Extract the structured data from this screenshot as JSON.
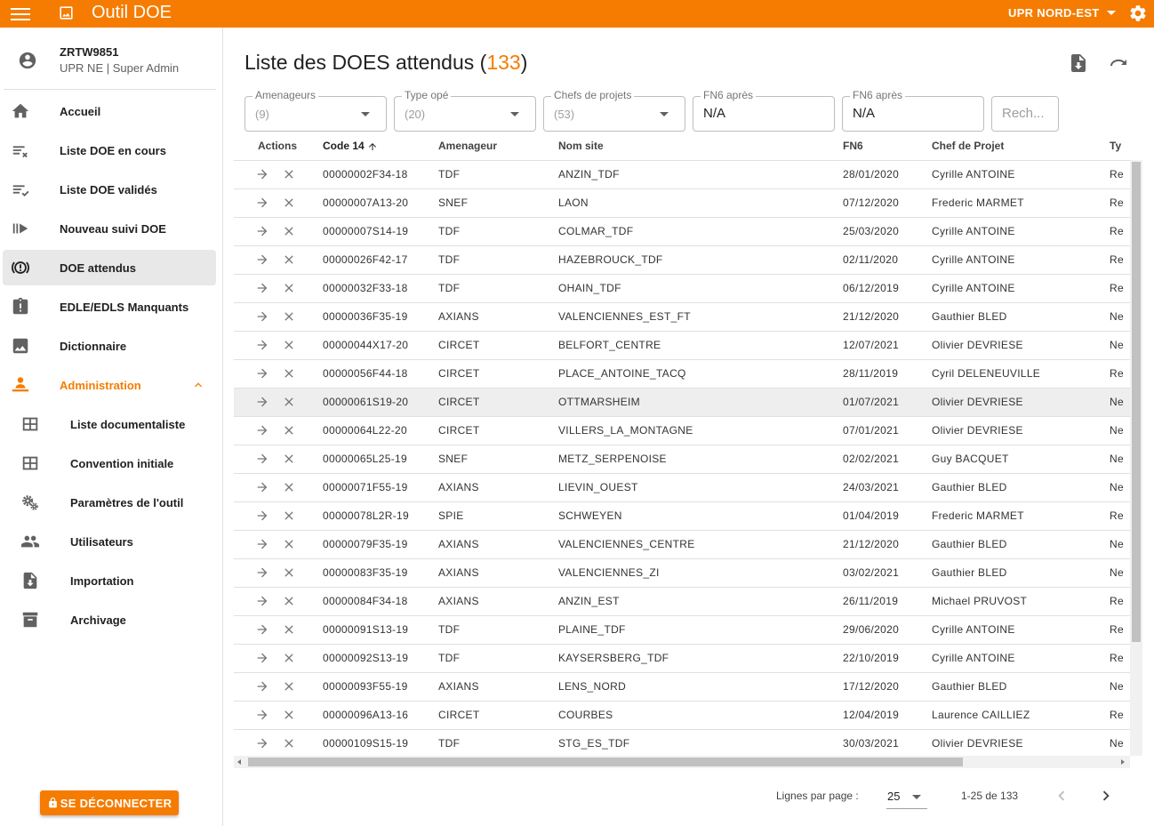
{
  "app": {
    "title": "Outil DOE",
    "region": "UPR NORD-EST"
  },
  "user": {
    "id": "ZRTW9851",
    "role": "UPR NE | Super Admin"
  },
  "nav": [
    {
      "label": "Accueil",
      "icon": "home-icon"
    },
    {
      "label": "Liste DOE en cours",
      "icon": "list-clear-icon"
    },
    {
      "label": "Liste DOE validés",
      "icon": "list-check-icon"
    },
    {
      "label": "Nouveau suivi DOE",
      "icon": "play-track-icon"
    },
    {
      "label": "DOE attendus",
      "icon": "pending-actions-icon"
    },
    {
      "label": "EDLE/EDLS Manquants",
      "icon": "clipboard-alert-icon"
    },
    {
      "label": "Dictionnaire",
      "icon": "image-icon"
    },
    {
      "label": "Administration",
      "icon": "admin-person-icon"
    }
  ],
  "admin_sub": [
    {
      "label": "Liste documentaliste",
      "icon": "table-icon"
    },
    {
      "label": "Convention initiale",
      "icon": "table-icon"
    },
    {
      "label": "Paramètres de l'outil",
      "icon": "cogs-icon"
    },
    {
      "label": "Utilisateurs",
      "icon": "people-icon"
    },
    {
      "label": "Importation",
      "icon": "file-import-icon"
    },
    {
      "label": "Archivage",
      "icon": "archive-icon"
    }
  ],
  "logout_label": "SE DÉCONNECTER",
  "page": {
    "title": "Liste des DOES attendus (",
    "count": "133",
    "title_end": ")"
  },
  "filters": {
    "amenageurs": {
      "label": "Amenageurs",
      "value": "(9)"
    },
    "type_ope": {
      "label": "Type opé",
      "value": "(20)"
    },
    "chefs": {
      "label": "Chefs de projets",
      "value": "(53)"
    },
    "fn6_apres_1": {
      "label": "FN6 après",
      "value": "N/A"
    },
    "fn6_apres_2": {
      "label": "FN6 après",
      "value": "N/A"
    },
    "search": {
      "placeholder": "Rech..."
    }
  },
  "table": {
    "headers": [
      "Actions",
      "Code 14",
      "Amenageur",
      "Nom site",
      "FN6",
      "Chef de Projet",
      "Ty"
    ],
    "rows": [
      [
        "00000002F34-18",
        "TDF",
        "ANZIN_TDF",
        "28/01/2020",
        "Cyrille ANTOINE",
        "Re"
      ],
      [
        "00000007A13-20",
        "SNEF",
        "LAON",
        "07/12/2020",
        "Frederic MARMET",
        "Re"
      ],
      [
        "00000007S14-19",
        "TDF",
        "COLMAR_TDF",
        "25/03/2020",
        "Cyrille ANTOINE",
        "Re"
      ],
      [
        "00000026F42-17",
        "TDF",
        "HAZEBROUCK_TDF",
        "02/11/2020",
        "Cyrille ANTOINE",
        "Re"
      ],
      [
        "00000032F33-18",
        "TDF",
        "OHAIN_TDF",
        "06/12/2019",
        "Cyrille ANTOINE",
        "Re"
      ],
      [
        "00000036F35-19",
        "AXIANS",
        "VALENCIENNES_EST_FT",
        "21/12/2020",
        "Gauthier BLED",
        "Ne"
      ],
      [
        "00000044X17-20",
        "CIRCET",
        "BELFORT_CENTRE",
        "12/07/2021",
        "Olivier DEVRIESE",
        "Ne"
      ],
      [
        "00000056F44-18",
        "CIRCET",
        "PLACE_ANTOINE_TACQ",
        "28/11/2019",
        "Cyril DELENEUVILLE",
        "Re"
      ],
      [
        "00000061S19-20",
        "CIRCET",
        "OTTMARSHEIM",
        "01/07/2021",
        "Olivier DEVRIESE",
        "Ne"
      ],
      [
        "00000064L22-20",
        "CIRCET",
        "VILLERS_LA_MONTAGNE",
        "07/01/2021",
        "Olivier DEVRIESE",
        "Ne"
      ],
      [
        "00000065L25-19",
        "SNEF",
        "METZ_SERPENOISE",
        "02/02/2021",
        "Guy BACQUET",
        "Ne"
      ],
      [
        "00000071F55-19",
        "AXIANS",
        "LIEVIN_OUEST",
        "24/03/2021",
        "Gauthier BLED",
        "Ne"
      ],
      [
        "00000078L2R-19",
        "SPIE",
        "SCHWEYEN",
        "01/04/2019",
        "Frederic MARMET",
        "Re"
      ],
      [
        "00000079F35-19",
        "AXIANS",
        "VALENCIENNES_CENTRE",
        "21/12/2020",
        "Gauthier BLED",
        "Ne"
      ],
      [
        "00000083F35-19",
        "AXIANS",
        "VALENCIENNES_ZI",
        "03/02/2021",
        "Gauthier BLED",
        "Ne"
      ],
      [
        "00000084F34-18",
        "AXIANS",
        "ANZIN_EST",
        "26/11/2019",
        "Michael PRUVOST",
        "Re"
      ],
      [
        "00000091S13-19",
        "TDF",
        "PLAINE_TDF",
        "29/06/2020",
        "Cyrille ANTOINE",
        "Re"
      ],
      [
        "00000092S13-19",
        "TDF",
        "KAYSERSBERG_TDF",
        "22/10/2019",
        "Cyrille ANTOINE",
        "Re"
      ],
      [
        "00000093F55-19",
        "AXIANS",
        "LENS_NORD",
        "17/12/2020",
        "Gauthier BLED",
        "Ne"
      ],
      [
        "00000096A13-16",
        "CIRCET",
        "COURBES",
        "12/04/2019",
        "Laurence CAILLIEZ",
        "Re"
      ],
      [
        "00000109S15-19",
        "TDF",
        "STG_ES_TDF",
        "30/03/2021",
        "Olivier DEVRIESE",
        "Ne"
      ]
    ],
    "highlighted_row": 8
  },
  "pagination": {
    "label": "Lignes par page :",
    "per_page": "25",
    "range": "1-25 de 133"
  },
  "colors": {
    "accent": "#f57c00",
    "active_bg": "#e8e8e8",
    "border": "#e0e0e0"
  }
}
